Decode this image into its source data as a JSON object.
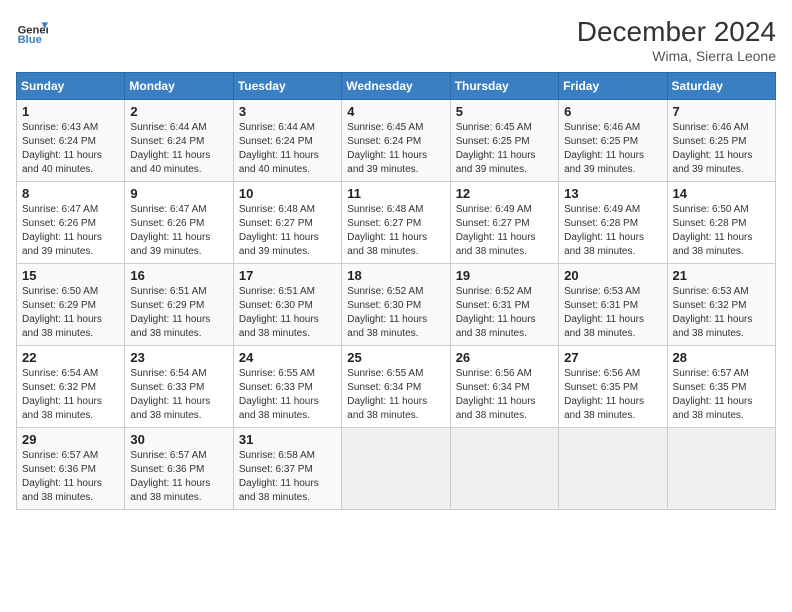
{
  "header": {
    "logo_line1": "General",
    "logo_line2": "Blue",
    "title": "December 2024",
    "subtitle": "Wima, Sierra Leone"
  },
  "weekdays": [
    "Sunday",
    "Monday",
    "Tuesday",
    "Wednesday",
    "Thursday",
    "Friday",
    "Saturday"
  ],
  "weeks": [
    [
      {
        "day": "1",
        "sunrise": "6:43 AM",
        "sunset": "6:24 PM",
        "daylight": "11 hours and 40 minutes."
      },
      {
        "day": "2",
        "sunrise": "6:44 AM",
        "sunset": "6:24 PM",
        "daylight": "11 hours and 40 minutes."
      },
      {
        "day": "3",
        "sunrise": "6:44 AM",
        "sunset": "6:24 PM",
        "daylight": "11 hours and 40 minutes."
      },
      {
        "day": "4",
        "sunrise": "6:45 AM",
        "sunset": "6:24 PM",
        "daylight": "11 hours and 39 minutes."
      },
      {
        "day": "5",
        "sunrise": "6:45 AM",
        "sunset": "6:25 PM",
        "daylight": "11 hours and 39 minutes."
      },
      {
        "day": "6",
        "sunrise": "6:46 AM",
        "sunset": "6:25 PM",
        "daylight": "11 hours and 39 minutes."
      },
      {
        "day": "7",
        "sunrise": "6:46 AM",
        "sunset": "6:25 PM",
        "daylight": "11 hours and 39 minutes."
      }
    ],
    [
      {
        "day": "8",
        "sunrise": "6:47 AM",
        "sunset": "6:26 PM",
        "daylight": "11 hours and 39 minutes."
      },
      {
        "day": "9",
        "sunrise": "6:47 AM",
        "sunset": "6:26 PM",
        "daylight": "11 hours and 39 minutes."
      },
      {
        "day": "10",
        "sunrise": "6:48 AM",
        "sunset": "6:27 PM",
        "daylight": "11 hours and 39 minutes."
      },
      {
        "day": "11",
        "sunrise": "6:48 AM",
        "sunset": "6:27 PM",
        "daylight": "11 hours and 38 minutes."
      },
      {
        "day": "12",
        "sunrise": "6:49 AM",
        "sunset": "6:27 PM",
        "daylight": "11 hours and 38 minutes."
      },
      {
        "day": "13",
        "sunrise": "6:49 AM",
        "sunset": "6:28 PM",
        "daylight": "11 hours and 38 minutes."
      },
      {
        "day": "14",
        "sunrise": "6:50 AM",
        "sunset": "6:28 PM",
        "daylight": "11 hours and 38 minutes."
      }
    ],
    [
      {
        "day": "15",
        "sunrise": "6:50 AM",
        "sunset": "6:29 PM",
        "daylight": "11 hours and 38 minutes."
      },
      {
        "day": "16",
        "sunrise": "6:51 AM",
        "sunset": "6:29 PM",
        "daylight": "11 hours and 38 minutes."
      },
      {
        "day": "17",
        "sunrise": "6:51 AM",
        "sunset": "6:30 PM",
        "daylight": "11 hours and 38 minutes."
      },
      {
        "day": "18",
        "sunrise": "6:52 AM",
        "sunset": "6:30 PM",
        "daylight": "11 hours and 38 minutes."
      },
      {
        "day": "19",
        "sunrise": "6:52 AM",
        "sunset": "6:31 PM",
        "daylight": "11 hours and 38 minutes."
      },
      {
        "day": "20",
        "sunrise": "6:53 AM",
        "sunset": "6:31 PM",
        "daylight": "11 hours and 38 minutes."
      },
      {
        "day": "21",
        "sunrise": "6:53 AM",
        "sunset": "6:32 PM",
        "daylight": "11 hours and 38 minutes."
      }
    ],
    [
      {
        "day": "22",
        "sunrise": "6:54 AM",
        "sunset": "6:32 PM",
        "daylight": "11 hours and 38 minutes."
      },
      {
        "day": "23",
        "sunrise": "6:54 AM",
        "sunset": "6:33 PM",
        "daylight": "11 hours and 38 minutes."
      },
      {
        "day": "24",
        "sunrise": "6:55 AM",
        "sunset": "6:33 PM",
        "daylight": "11 hours and 38 minutes."
      },
      {
        "day": "25",
        "sunrise": "6:55 AM",
        "sunset": "6:34 PM",
        "daylight": "11 hours and 38 minutes."
      },
      {
        "day": "26",
        "sunrise": "6:56 AM",
        "sunset": "6:34 PM",
        "daylight": "11 hours and 38 minutes."
      },
      {
        "day": "27",
        "sunrise": "6:56 AM",
        "sunset": "6:35 PM",
        "daylight": "11 hours and 38 minutes."
      },
      {
        "day": "28",
        "sunrise": "6:57 AM",
        "sunset": "6:35 PM",
        "daylight": "11 hours and 38 minutes."
      }
    ],
    [
      {
        "day": "29",
        "sunrise": "6:57 AM",
        "sunset": "6:36 PM",
        "daylight": "11 hours and 38 minutes."
      },
      {
        "day": "30",
        "sunrise": "6:57 AM",
        "sunset": "6:36 PM",
        "daylight": "11 hours and 38 minutes."
      },
      {
        "day": "31",
        "sunrise": "6:58 AM",
        "sunset": "6:37 PM",
        "daylight": "11 hours and 38 minutes."
      },
      null,
      null,
      null,
      null
    ]
  ]
}
